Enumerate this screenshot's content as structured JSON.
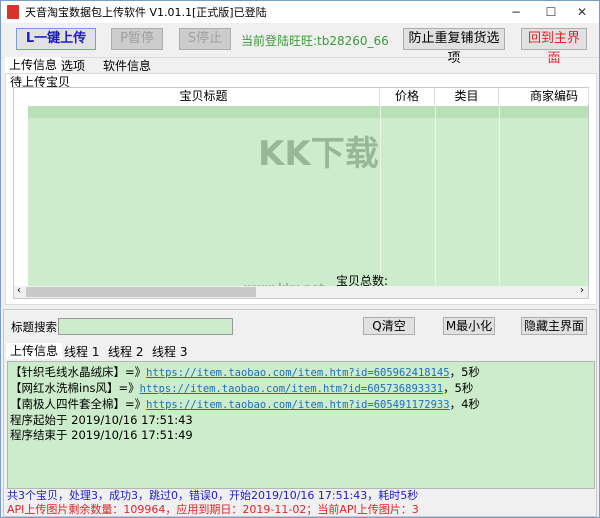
{
  "window": {
    "title": "天音淘宝数据包上传软件 V1.01.1[正式版]已登陆",
    "minimize": "−",
    "maximize": "☐",
    "close": "✕"
  },
  "toolbar": {
    "upload": "L一键上传",
    "pause": "P暂停",
    "stop": "S停止",
    "login_status": "当前登陆旺旺:tb28260_66",
    "dedupe": "防止重复铺货选项",
    "home": "回到主界面"
  },
  "tabs": [
    "上传信息",
    "选项",
    "软件信息"
  ],
  "group_label": "待上传宝贝",
  "table": {
    "columns": [
      "宝贝标题",
      "价格",
      "类目",
      "商家编码"
    ],
    "total_label": "宝贝总数:"
  },
  "watermark": {
    "logo": "KK下载",
    "url": "www.kkx.net"
  },
  "search": {
    "label": "标题搜索",
    "value": "",
    "clear": "Q清空",
    "minimize": "M最小化",
    "hide": "隐藏主界面"
  },
  "log_tabs": [
    "上传信息",
    "线程 1",
    "线程 2",
    "线程 3"
  ],
  "log": {
    "items": [
      {
        "name": "【针织毛线水晶绒床】=》",
        "url": "https://item.taobao.com/item.htm?id=605962418145",
        "time": "，5秒"
      },
      {
        "name": "【网红水洗棉ins风】=》",
        "url": "https://item.taobao.com/item.htm?id=605736893331",
        "time": "，5秒"
      },
      {
        "name": "【南极人四件套全棉】=》",
        "url": "https://item.taobao.com/item.htm?id=605491172933",
        "time": "，4秒"
      }
    ],
    "start": "程序起始于 2019/10/16 17:51:43",
    "end": "程序结束于 2019/10/16 17:51:49"
  },
  "status": {
    "summary": "共3个宝贝，处理3，成功3，跳过0，错误0，开始2019/10/16 17:51:43，耗时5秒",
    "api": "API上传图片剩余数量：109964，应用到期日：2019-11-02；当前API上传图片：3"
  },
  "colors": {
    "grid": "#cdeccb",
    "green_text": "#3a9a3a",
    "red": "#e0242b",
    "blue": "#1c1ccc"
  }
}
